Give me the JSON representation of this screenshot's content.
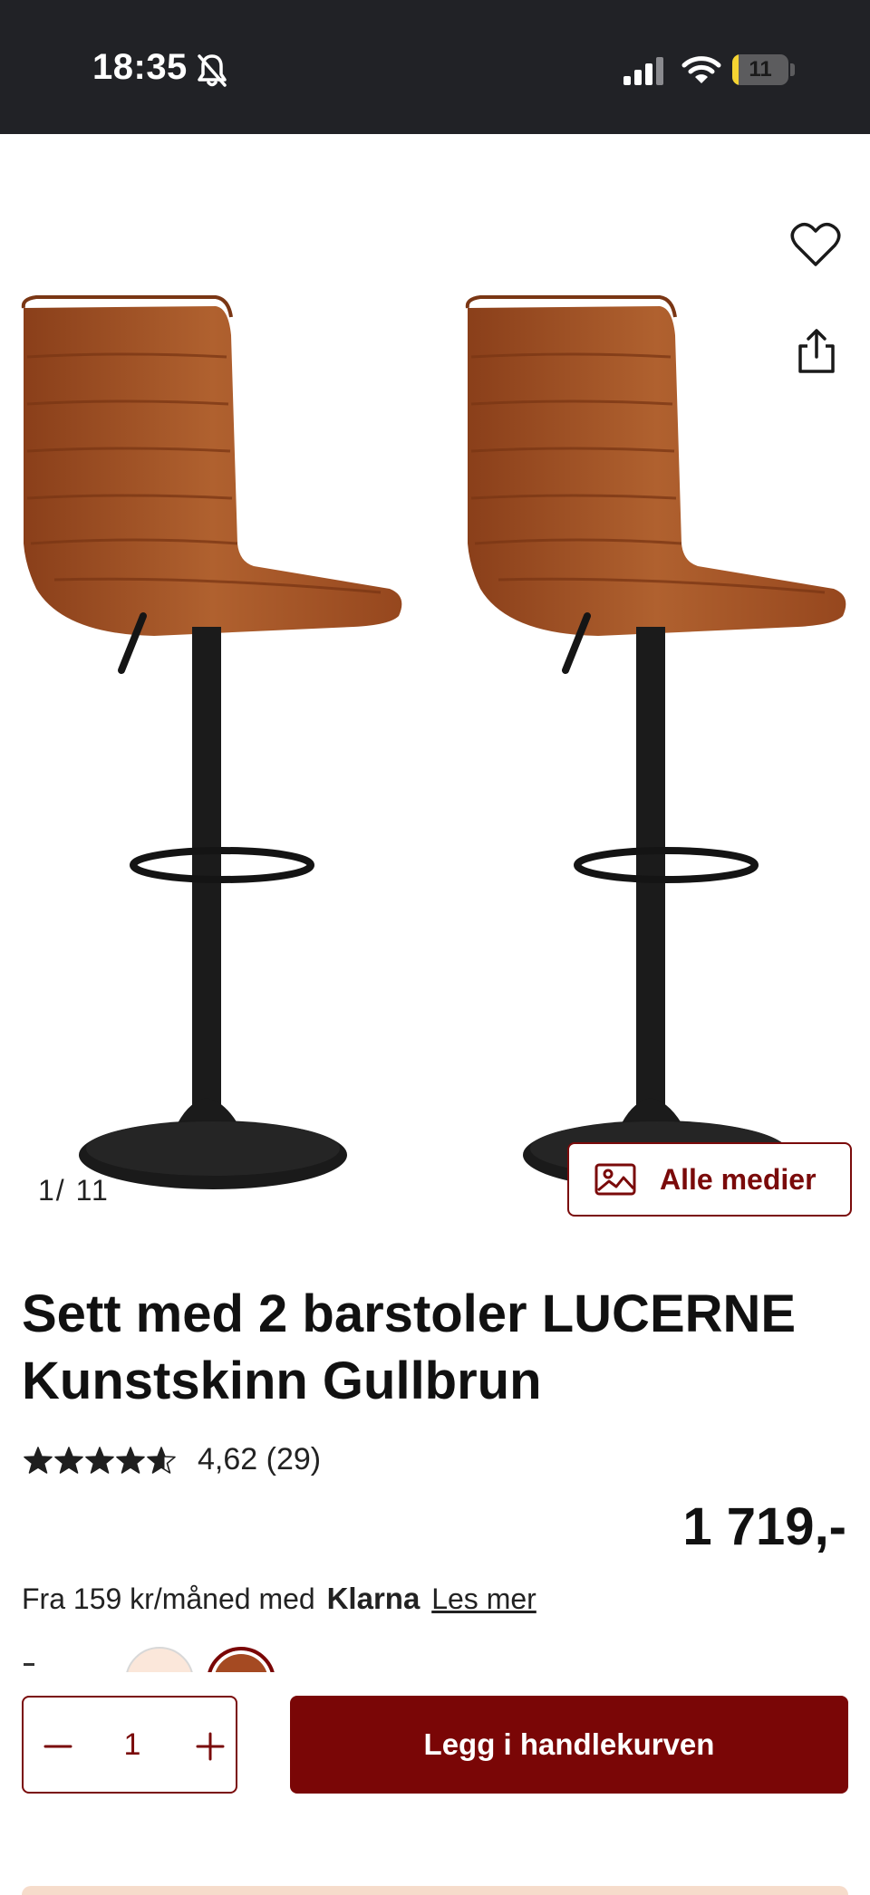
{
  "status_bar": {
    "time": "18:35",
    "battery_percent": 11,
    "battery_label": "11",
    "icons": [
      "bell-slash-icon",
      "cellular-signal-icon",
      "wifi-icon",
      "battery-icon"
    ]
  },
  "gallery": {
    "counter_current": "1",
    "counter_separator": "/",
    "counter_total": "11",
    "all_media_label": "Alle medier",
    "icons": [
      "heart-icon",
      "share-icon",
      "image-icon"
    ]
  },
  "product": {
    "title": "Sett med 2 barstoler LUCERNE Kunstskinn Gullbrun",
    "rating_value": 4.62,
    "rating_text": "4,62 (29)",
    "price": "1 719,-",
    "financing_prefix": "Fra 159 kr/måned med",
    "financing_brand": "Klarna",
    "financing_link": "Les mer"
  },
  "swatches": {
    "colors": [
      "#fbe7da",
      "#a54a22"
    ],
    "selected_index": 1
  },
  "cart": {
    "quantity": "1",
    "add_label": "Legg i handlekurven"
  },
  "colors": {
    "brand": "#7a0606",
    "leather": "#a85a2a",
    "status_bar": "#212226"
  }
}
